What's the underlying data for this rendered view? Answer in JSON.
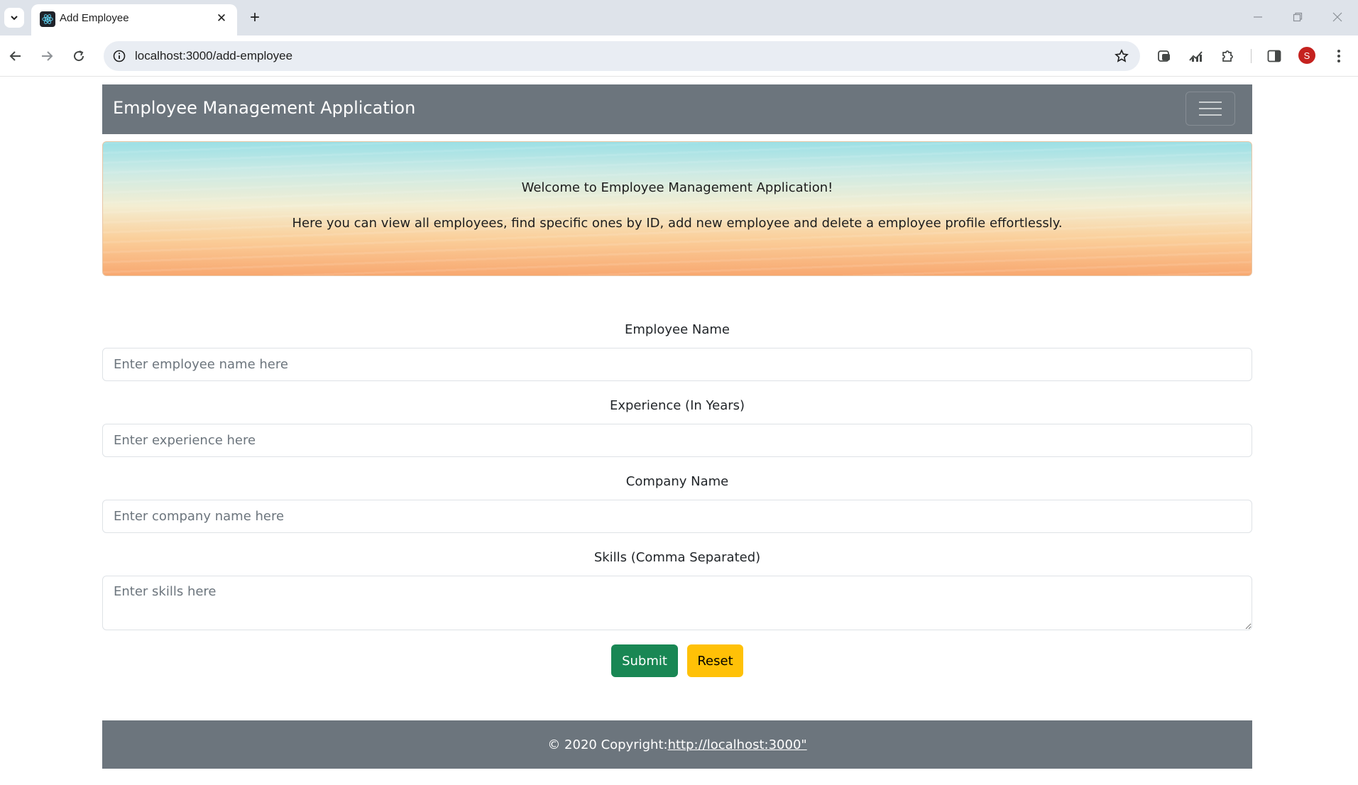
{
  "browser": {
    "tab_title": "Add Employee",
    "tab_close_glyph": "✕",
    "new_tab_glyph": "+",
    "url": "localhost:3000/add-employee",
    "profile_initial": "S",
    "icons": [
      "tab-search-icon",
      "react-favicon-icon",
      "back-arrow-icon",
      "forward-arrow-icon",
      "reload-icon",
      "site-info-icon",
      "bookmark-star-icon",
      "extension-icon",
      "puzzle-icon",
      "side-panel-icon",
      "kebab-menu-icon",
      "minimize-icon",
      "restore-icon",
      "close-window-icon"
    ],
    "avatar_color": "#c5221f"
  },
  "navbar": {
    "brand": "Employee Management Application",
    "background": "#6c757d"
  },
  "banner": {
    "line1": "Welcome to Employee Management Application!",
    "line2": "Here you can view all employees, find specific ones by ID, add new employee and delete a employee profile effortlessly."
  },
  "form": {
    "name_label": "Employee Name",
    "name_placeholder": "Enter employee name here",
    "experience_label": "Experience (In Years)",
    "experience_placeholder": "Enter experience here",
    "company_label": "Company Name",
    "company_placeholder": "Enter company name here",
    "skills_label": "Skills (Comma Separated)",
    "skills_placeholder": "Enter skills here",
    "submit_label": "Submit",
    "reset_label": "Reset",
    "submit_color": "#198754",
    "reset_color": "#ffc107"
  },
  "footer": {
    "copyright": "© 2020 Copyright:",
    "link_text": "http://localhost:3000\""
  }
}
